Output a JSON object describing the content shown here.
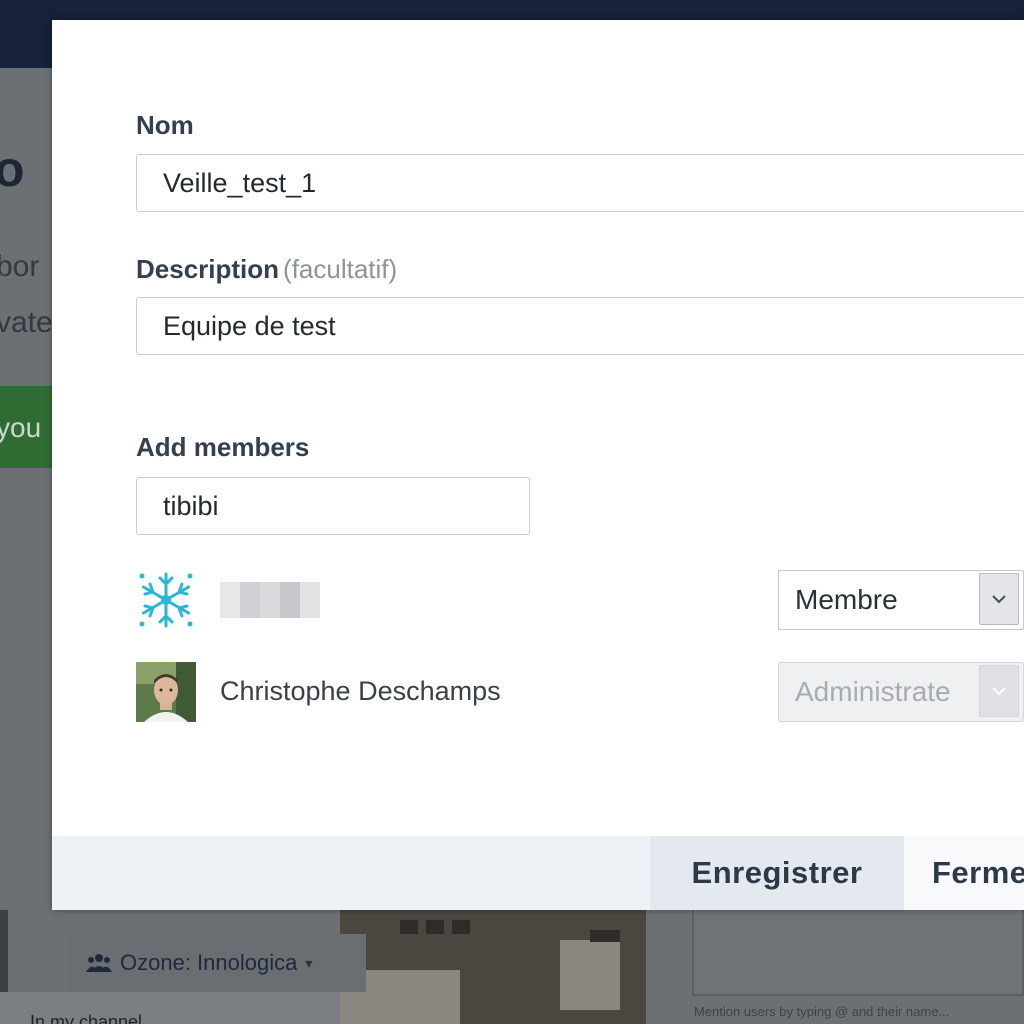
{
  "background": {
    "heading_fragment": "o",
    "line1_fragment": "bor",
    "line2_fragment": "vate",
    "green_button_fragment": "you",
    "group_selector": {
      "label": "Ozone: Innologica",
      "icon": "group-icon",
      "caret": "▾"
    },
    "panel_text": "In my channel",
    "mention_hint": "Mention users by typing @ and their name..."
  },
  "modal": {
    "name_field": {
      "label": "Nom",
      "value": "Veille_test_1"
    },
    "description_field": {
      "label": "Description",
      "optional_hint": "(facultatif)",
      "value": "Equipe de test"
    },
    "add_members": {
      "label": "Add members",
      "value": "tibibi"
    },
    "members": [
      {
        "name": "",
        "avatar": "snowflake-avatar",
        "role": "Membre",
        "role_disabled": false
      },
      {
        "name": "Christophe Deschamps",
        "avatar": "person-photo-avatar",
        "role": "Administrate",
        "role_disabled": true
      }
    ],
    "footer": {
      "save_label": "Enregistrer",
      "close_label": "Ferme"
    }
  },
  "colors": {
    "topbar": "#16213a",
    "label": "#34404e",
    "footer": "#eef1f6",
    "snowflake": "#2bb6d6"
  }
}
